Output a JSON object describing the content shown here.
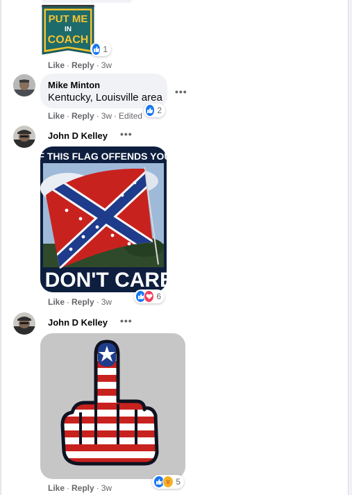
{
  "comments": [
    {
      "id": "sticker",
      "sticker_text": [
        "PUT ME",
        "IN",
        "COACH"
      ],
      "reaction_count": "1",
      "actions": {
        "like": "Like",
        "reply": "Reply",
        "time": "3w",
        "edited": ""
      }
    },
    {
      "id": "mike",
      "author": "Mike Minton",
      "text": "Kentucky, Louisville area",
      "reaction_count": "2",
      "actions": {
        "like": "Like",
        "reply": "Reply",
        "time": "3w",
        "edited": "Edited"
      }
    },
    {
      "id": "john1",
      "author": "John D Kelley",
      "meme_top": "IF THIS FLAG OFFENDS YOU",
      "meme_bottom": "I DON'T CARE",
      "reaction_count": "6",
      "actions": {
        "like": "Like",
        "reply": "Reply",
        "time": "3w"
      }
    },
    {
      "id": "john2",
      "author": "John D Kelley",
      "reaction_count": "5",
      "actions": {
        "like": "Like",
        "reply": "Reply",
        "time": "3w"
      }
    }
  ],
  "icons": {
    "more": "more-options-icon",
    "like": "like-reaction-icon",
    "love": "love-reaction-icon",
    "care": "care-reaction-icon"
  },
  "colors": {
    "like_blue": "#1877f2",
    "love_red": "#f33e58",
    "muted": "#65676b",
    "bubble": "#f0f2f5"
  }
}
